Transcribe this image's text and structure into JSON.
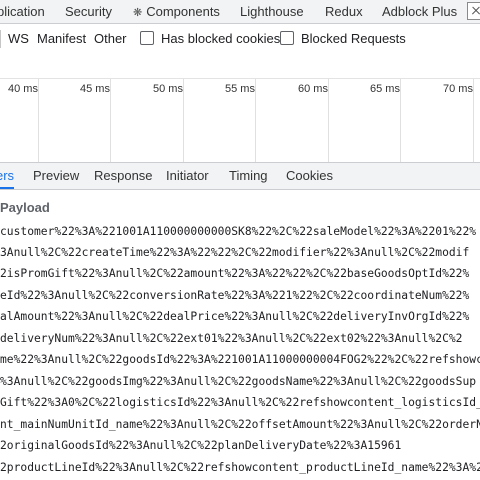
{
  "top_tabs": [
    {
      "label": "plication",
      "icon": ""
    },
    {
      "label": "Security",
      "icon": ""
    },
    {
      "label": "Components",
      "icon": "gear-icon"
    },
    {
      "label": "Lighthouse",
      "icon": ""
    },
    {
      "label": "Redux",
      "icon": ""
    },
    {
      "label": "Adblock Plus",
      "icon": ""
    }
  ],
  "filter": {
    "types": [
      "WS",
      "Manifest",
      "Other"
    ],
    "checkboxes": [
      {
        "label": "Has blocked cookies",
        "checked": false
      },
      {
        "label": "Blocked Requests",
        "checked": false
      }
    ]
  },
  "timeline": {
    "ticks": [
      "40 ms",
      "45 ms",
      "50 ms",
      "55 ms",
      "60 ms",
      "65 ms",
      "70 ms"
    ]
  },
  "detail_tabs": [
    {
      "label": "ers",
      "active": true
    },
    {
      "label": "Preview",
      "active": false
    },
    {
      "label": "Response",
      "active": false
    },
    {
      "label": "Initiator",
      "active": false
    },
    {
      "label": "Timing",
      "active": false
    },
    {
      "label": "Cookies",
      "active": false
    }
  ],
  "payload": {
    "title": "Payload",
    "lines": [
      "customer%22%3A%221001A110000000000SK8%22%2C%22saleModel%22%3A%2201%22%",
      "3Anull%2C%22createTime%22%3A%22%22%2C%22modifier%22%3Anull%2C%22modif",
      "2isPromGift%22%3Anull%2C%22amount%22%3A%22%22%2C%22baseGoodsOptId%22%",
      "eId%22%3Anull%2C%22conversionRate%22%3A%221%22%2C%22coordinateNum%22%",
      "alAmount%22%3Anull%2C%22dealPrice%22%3Anull%2C%22deliveryInvOrgId%22%",
      "deliveryNum%22%3Anull%2C%22ext01%22%3Anull%2C%22ext02%22%3Anull%2C%2",
      "me%22%3Anull%2C%22goodsId%22%3A%221001A11000000004FOG2%22%2C%22refshowc",
      "%3Anull%2C%22goodsImg%22%3Anull%2C%22goodsName%22%3Anull%2C%22goodsSup",
      "Gift%22%3A0%2C%22logisticsId%22%3Anull%2C%22refshowcontent_logisticsId_",
      "nt_mainNumUnitId_name%22%3Anull%2C%22offsetAmount%22%3Anull%2C%22orderN",
      "2originalGoodsId%22%3Anull%2C%22planDeliveryDate%22%3A15961",
      "2productLineId%22%3Anull%2C%22refshowcontent_productLineId_name%22%3A%22"
    ]
  }
}
